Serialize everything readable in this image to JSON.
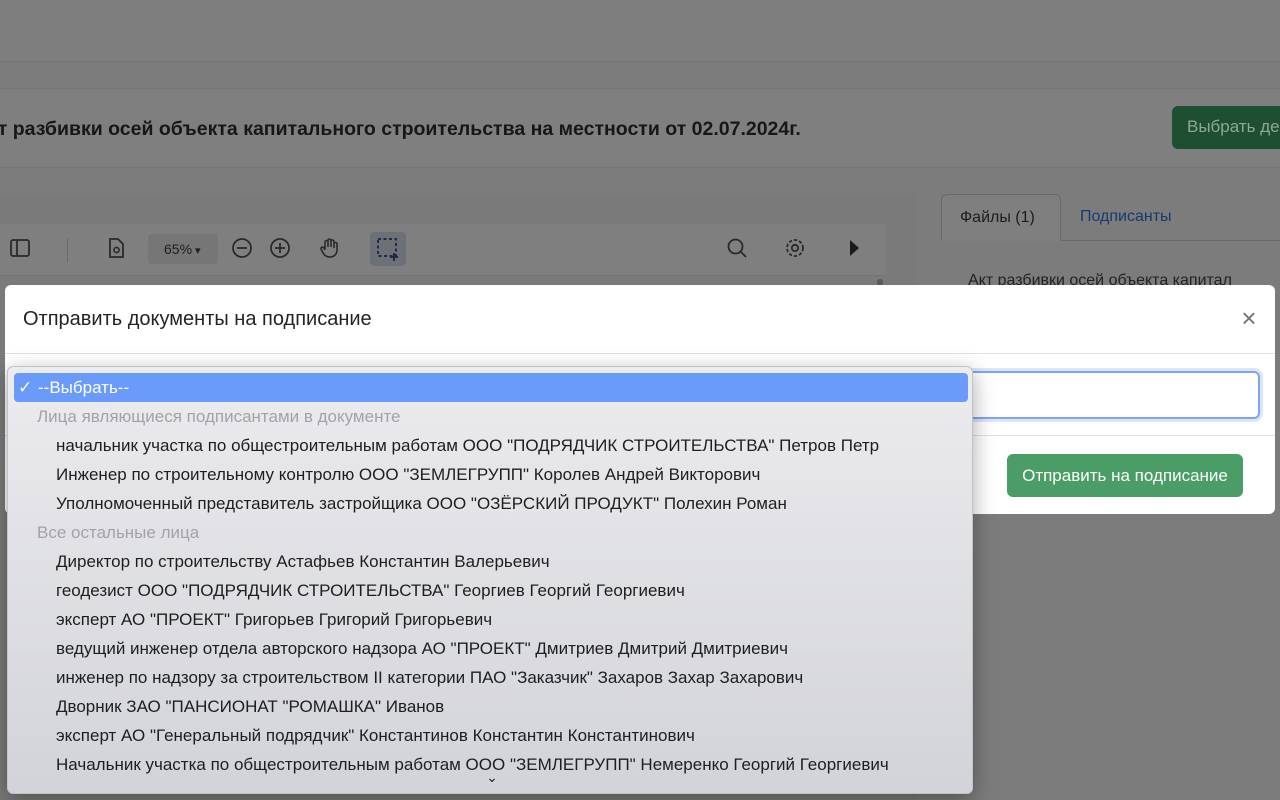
{
  "document": {
    "title": "кт разбивки осей объекта капитального строительства на местности от 02.07.2024г.",
    "pick_button_label": "Выбрать де"
  },
  "viewer": {
    "zoom": "65%"
  },
  "side_panel": {
    "tabs": [
      {
        "label": "Файлы (1)",
        "active": true
      },
      {
        "label": "Подписанты",
        "active": false
      }
    ],
    "file_name": "Акт разбивки осей объекта капитал"
  },
  "modal": {
    "title": "Отправить документы на подписание",
    "close_symbol": "×",
    "submit_label": "Отправить на подписание"
  },
  "dropdown": {
    "selected": "--Выбрать--",
    "check_mark": "✓",
    "groups": [
      {
        "label": "Лица являющиеся подписантами в документе",
        "options": [
          "начальник участка по общестроительным работам ООО \"ПОДРЯДЧИК СТРОИТЕЛЬСТВА\" Петров Петр",
          "Инженер по строительному контролю ООО \"ЗЕМЛЕГРУПП\" Королев Андрей Викторович",
          "Уполномоченный представитель застройщика ООО \"ОЗЁРСКИЙ ПРОДУКТ\" Полехин Роман"
        ]
      },
      {
        "label": "Все остальные лица",
        "options": [
          "Директор по строительству Астафьев Константин Валерьевич",
          "геодезист ООО \"ПОДРЯДЧИК СТРОИТЕЛЬСТВА\" Георгиев Георгий Георгиевич",
          "эксперт АО \"ПРОЕКТ\" Григорьев Григорий Григорьевич",
          "ведущий инженер отдела авторского надзора АО \"ПРОЕКТ\" Дмитриев Дмитрий Дмитриевич",
          "инженер по надзору за строительством II категории ПАО \"Заказчик\" Захаров Захар Захарович",
          "Дворник ЗАО \"ПАНСИОНАТ \"РОМАШКА\" Иванов",
          "эксперт АО \"Генеральный подрядчик\" Константинов Константин Константинович",
          "Начальник участка по общестроительным работам ООО \"ЗЕМЛЕГРУПП\" Немеренко Георгий Георгиевич"
        ]
      }
    ],
    "scroll_more_symbol": "⌄"
  }
}
